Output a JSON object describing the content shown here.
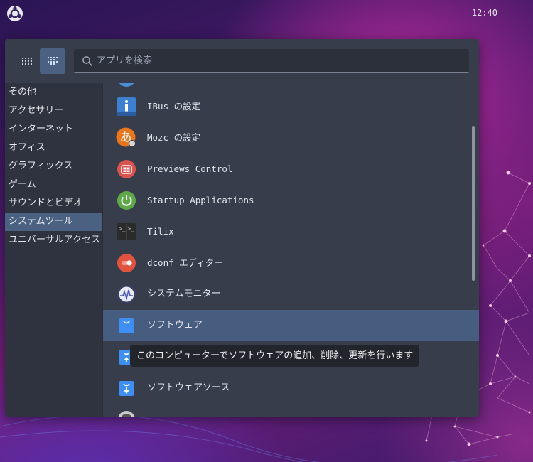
{
  "topbar": {
    "clock": "12:40",
    "app_menu_icon": "ubuntu-logo-icon"
  },
  "menu": {
    "view_buttons": {
      "grid_icon": "grid-dots-icon",
      "list_icon": "list-dots-icon",
      "active": "list"
    },
    "search": {
      "placeholder": "アプリを検索",
      "value": ""
    },
    "categories": [
      {
        "label": "その他",
        "selected": false
      },
      {
        "label": "アクセサリー",
        "selected": false
      },
      {
        "label": "インターネット",
        "selected": false
      },
      {
        "label": "オフィス",
        "selected": false
      },
      {
        "label": "グラフィックス",
        "selected": false
      },
      {
        "label": "ゲーム",
        "selected": false
      },
      {
        "label": "サウンドとビデオ",
        "selected": false
      },
      {
        "label": "システムツール",
        "selected": true
      },
      {
        "label": "ユニバーサルアクセス",
        "selected": false
      }
    ],
    "apps": [
      {
        "label": "",
        "icon": "partial-blue-icon"
      },
      {
        "label": "IBus の設定",
        "icon": "info-icon"
      },
      {
        "label": "Mozc の設定",
        "icon": "mozc-icon"
      },
      {
        "label": "Previews Control",
        "icon": "previews-control-icon"
      },
      {
        "label": "Startup Applications",
        "icon": "power-icon"
      },
      {
        "label": "Tilix",
        "icon": "terminal-icon"
      },
      {
        "label": "dconf エディター",
        "icon": "dconf-icon"
      },
      {
        "label": "システムモニター",
        "icon": "system-monitor-icon"
      },
      {
        "label": "ソフトウェア",
        "icon": "software-bag-icon",
        "selected": true
      },
      {
        "label": "",
        "icon": "software-update-icon"
      },
      {
        "label": "ソフトウェアソース",
        "icon": "software-sources-icon"
      },
      {
        "label": "",
        "icon": "partial-gray-icon"
      }
    ],
    "tooltip": "このコンピューターでソフトウェアの追加、削除、更新を行います"
  },
  "colors": {
    "menu_bg": "#383d4b",
    "sidebar_bg": "#2f333f",
    "selection": "#465d80",
    "tooltip_bg": "#22252c"
  }
}
